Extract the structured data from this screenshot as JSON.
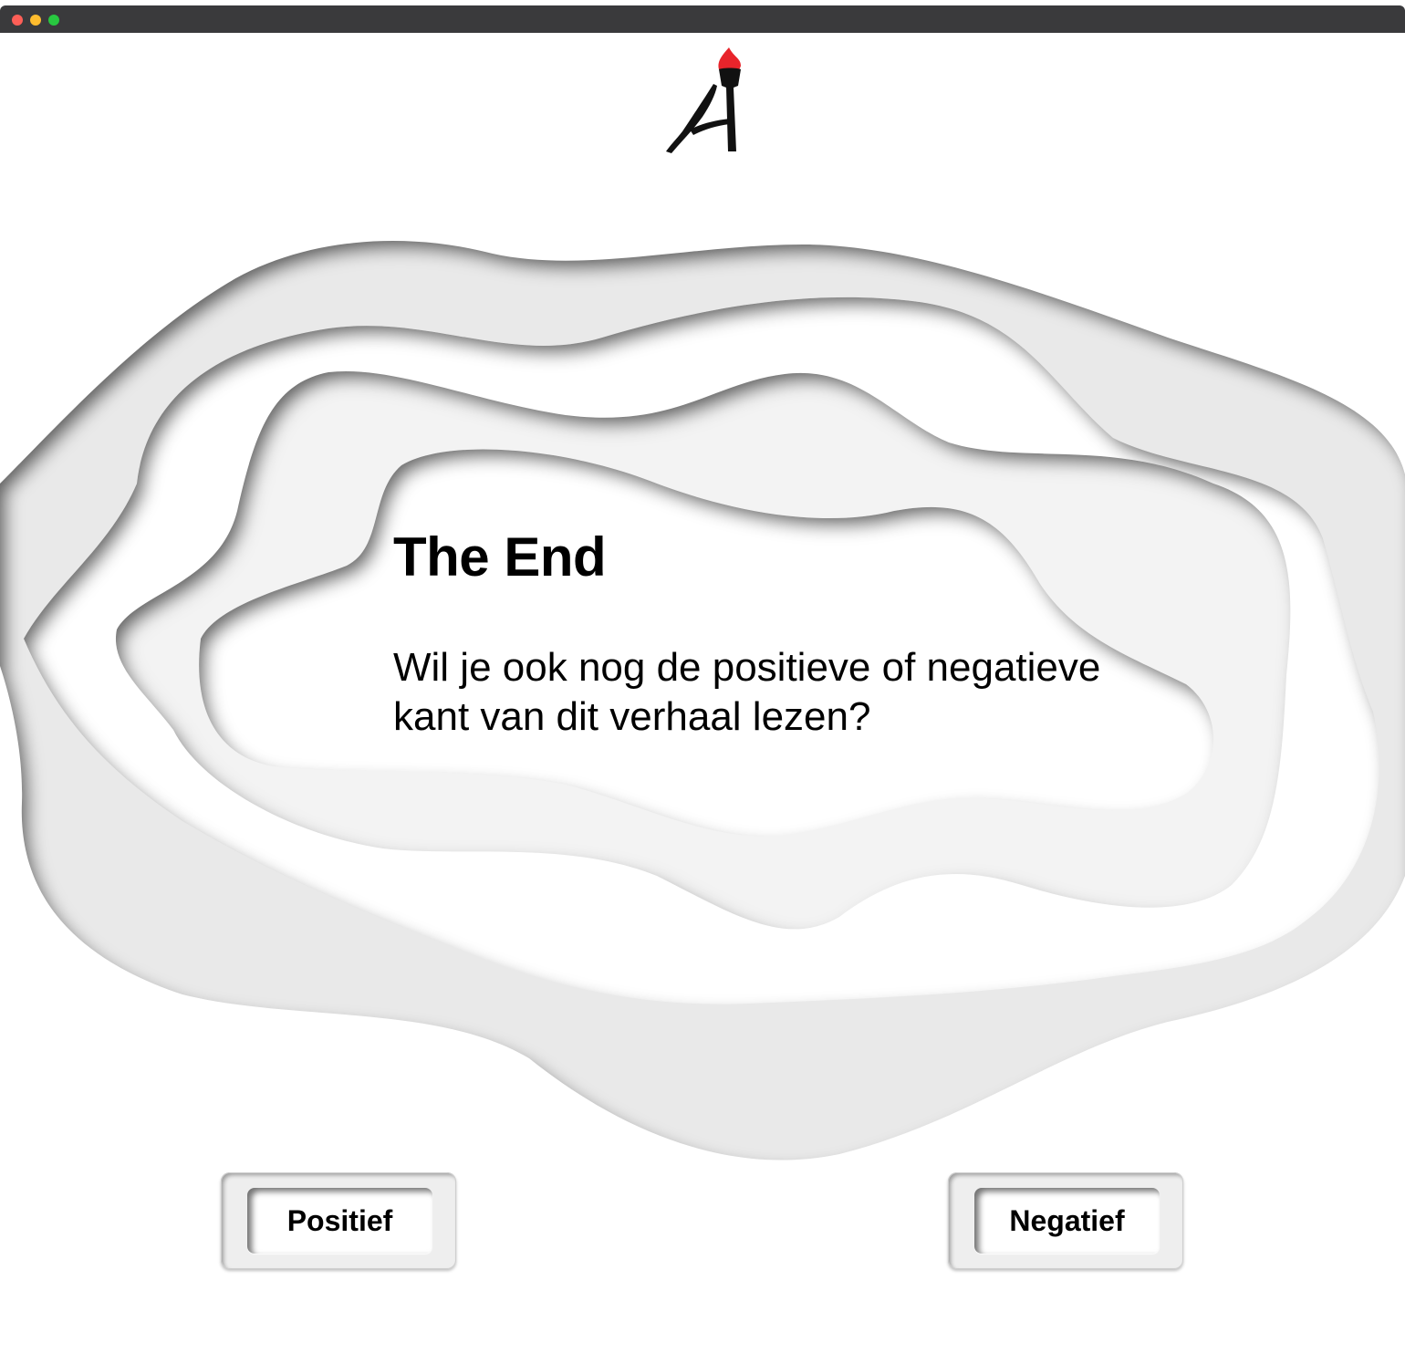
{
  "window": {
    "controls": [
      "close",
      "minimize",
      "maximize"
    ]
  },
  "logo": {
    "icon": "torch-letter-a-logo",
    "flame_color": "#e8242b"
  },
  "story": {
    "title": "The End",
    "question": "Wil je ook nog de positieve of negatieve kant van dit verhaal lezen?"
  },
  "buttons": {
    "positive_label": "Positief",
    "negative_label": "Negatief"
  }
}
